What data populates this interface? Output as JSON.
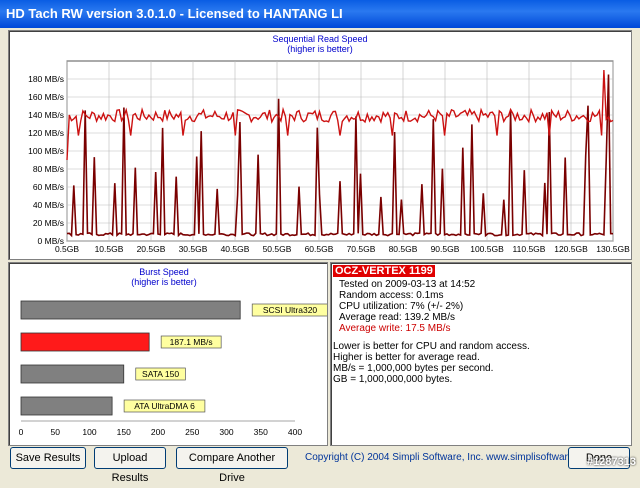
{
  "window": {
    "title": "HD Tach RW version 3.0.1.0 - Licensed to HANTANG LI"
  },
  "seq_chart": {
    "title": "Sequential Read Speed",
    "subtitle": "(higher is better)",
    "y_ticks": [
      "0 MB/s",
      "20 MB/s",
      "40 MB/s",
      "60 MB/s",
      "80 MB/s",
      "100 MB/s",
      "120 MB/s",
      "140 MB/s",
      "160 MB/s",
      "180 MB/s"
    ],
    "x_ticks": [
      "0.5GB",
      "10.5GB",
      "20.5GB",
      "30.5GB",
      "40.5GB",
      "50.5GB",
      "60.5GB",
      "70.5GB",
      "80.5GB",
      "90.5GB",
      "100.5GB",
      "110.5GB",
      "120.5GB",
      "130.5GB"
    ]
  },
  "chart_data": [
    {
      "type": "line",
      "title": "Sequential Read Speed",
      "subtitle": "(higher is better)",
      "ylim": [
        0,
        200
      ],
      "xlim": [
        0.5,
        130.5
      ],
      "series": [
        {
          "name": "read",
          "color": "#cc1111",
          "level": 139.2
        },
        {
          "name": "write",
          "color": "#7a0000",
          "level": 17.5
        }
      ]
    },
    {
      "type": "bar",
      "title": "Burst Speed",
      "subtitle": "(higher is better)",
      "categories": [
        "SCSI Ultra320",
        "187.1 MB/s",
        "SATA 150",
        "ATA UltraDMA 6"
      ],
      "values": [
        320,
        187.1,
        150,
        133
      ],
      "colors": [
        "#808080",
        "#ff1a1a",
        "#808080",
        "#808080"
      ],
      "x_ticks": [
        "0",
        "50",
        "100",
        "150",
        "200",
        "250",
        "300",
        "350",
        "400"
      ],
      "xlim": [
        0,
        400
      ]
    }
  ],
  "info": {
    "drive": "OCZ-VERTEX 1199",
    "tested": "Tested on 2009-03-13 at 14:52",
    "random_access": "Random access: 0.1ms",
    "cpu": "CPU utilization: 7% (+/- 2%)",
    "avg_read": "Average read: 139.2 MB/s",
    "avg_write": "Average write: 17.5 MB/s",
    "note1": "Lower is better for CPU and random access.",
    "note2": "Higher is better for average read.",
    "note3": "MB/s = 1,000,000 bytes per second.",
    "note4": "GB = 1,000,000,000 bytes."
  },
  "buttons": {
    "save": "Save Results",
    "upload": "Upload Results",
    "compare": "Compare Another Drive",
    "done": "Done"
  },
  "copyright": "Copyright (C) 2004 Simpli Software, Inc. www.simplisoftware.com",
  "watermark": "#1287313",
  "colors": {
    "read_line": "#cc1111",
    "write_line": "#7a0000",
    "highlight_bar": "#ff1a1a",
    "title_bar": "#0a5de3"
  }
}
